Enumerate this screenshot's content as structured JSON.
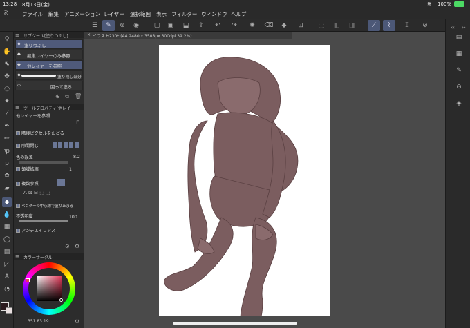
{
  "status": {
    "time": "13:28",
    "date": "8月13日(金)",
    "battery": "100%"
  },
  "menu": [
    "ファイル",
    "編集",
    "アニメーション",
    "レイヤー",
    "選択範囲",
    "表示",
    "フィルター",
    "ウィンドウ",
    "ヘルプ"
  ],
  "subtool": {
    "title": "サブツール[塗りつぶし]",
    "items": [
      "塗りつぶし",
      "編集レイヤーのみ参照",
      "他レイヤーを参照",
      "塗り残し部分に塗る",
      "囲って塗る"
    ]
  },
  "toolprop": {
    "title": "ツールプロパティ[他レイ",
    "subtitle": "他レイヤーを参照",
    "adjacent_pixels": "隣接ピクセルをたどる",
    "gap_close": "隙間閉じ",
    "color_margin_label": "色の誤差",
    "color_margin_value": "8.2",
    "area_scale_label": "領域拡縮",
    "area_scale_value": "1",
    "multi_ref": "複数参照",
    "vector_center": "ベクターの中心線で塗り止まる",
    "opacity_label": "不透明度",
    "opacity_value": "100",
    "antialias": "アンチエイリアス"
  },
  "color_panel": {
    "title": "カラーサークル",
    "readout": "351 83 19"
  },
  "document": {
    "tab": "イラスト230* (A4 2480 x 3508px 300dpi 39.2%)"
  },
  "colors": {
    "accent": "#4c5877",
    "line_art": "#7b5d5f"
  }
}
